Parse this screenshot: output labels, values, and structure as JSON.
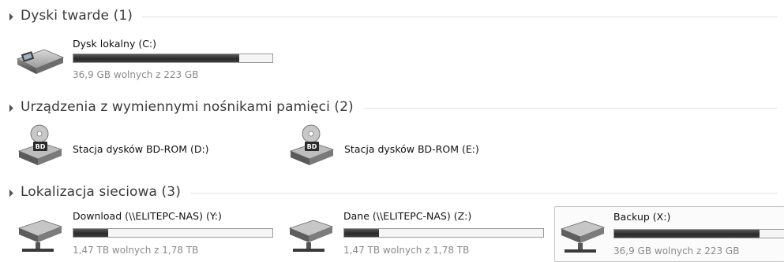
{
  "groups": [
    {
      "title": "Dyski twarde (1)",
      "drives": [
        {
          "name": "Dysk lokalny (C:)",
          "free_text": "36,9 GB wolnych z 223 GB",
          "used_fraction": 0.835,
          "icon": "hard-disk-icon"
        }
      ]
    },
    {
      "title": "Urządzenia z wymiennymi nośnikami pamięci (2)",
      "drives": [
        {
          "name": "Stacja dysków BD-ROM (D:)",
          "icon": "bd-rom-drive-icon"
        },
        {
          "name": "Stacja dysków BD-ROM (E:)",
          "icon": "bd-rom-drive-icon"
        }
      ]
    },
    {
      "title": "Lokalizacja sieciowa (3)",
      "drives": [
        {
          "name": "Download (\\\\ELITEPC-NAS) (Y:)",
          "free_text": "1,47 TB wolnych z 1,78 TB",
          "used_fraction": 0.174,
          "icon": "network-drive-icon"
        },
        {
          "name": "Dane (\\\\ELITEPC-NAS) (Z:)",
          "free_text": "1,47 TB wolnych z 1,78 TB",
          "used_fraction": 0.174,
          "icon": "network-drive-icon"
        },
        {
          "name": "Backup (X:)",
          "free_text": "36,9 GB wolnych z 223 GB",
          "used_fraction": 0.835,
          "icon": "network-drive-icon",
          "selected": true
        }
      ]
    }
  ],
  "colors": {
    "bar_fill": "#2b2b2b",
    "bar_border": "#9a9a9a",
    "free_text": "#8a8a8a",
    "header_line": "#e2e2e2"
  }
}
